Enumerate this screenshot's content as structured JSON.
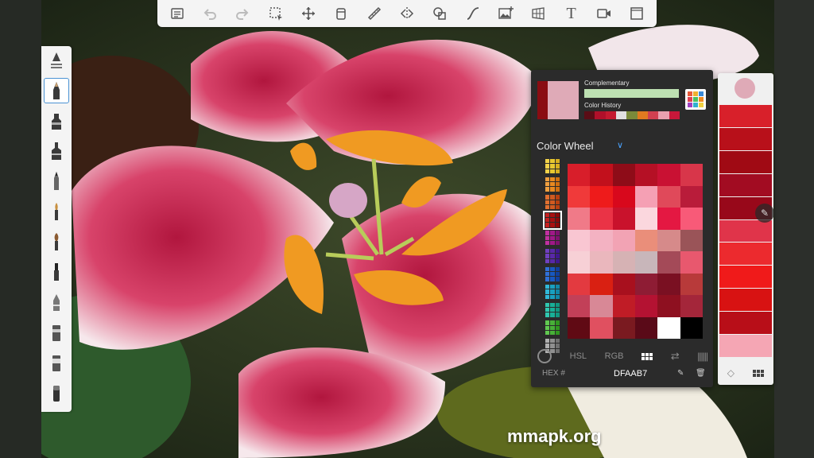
{
  "toolbar": {
    "icons": [
      "list-icon",
      "undo-icon",
      "redo-icon",
      "selection-icon",
      "move-icon",
      "fill-icon",
      "ruler-icon",
      "symmetry-icon",
      "shapes-icon",
      "curve-icon",
      "import-image-icon",
      "perspective-icon",
      "text-icon",
      "video-icon",
      "fullscreen-icon"
    ],
    "text_label": "T"
  },
  "brushes": [
    "brush-settings-icon",
    "pencil-icon",
    "marker-icon",
    "airbrush-icon",
    "ink-pen-icon",
    "paint-brush-icon",
    "round-brush-icon",
    "flat-brush-icon",
    "blender-icon",
    "smudge-icon",
    "solid-fill-icon",
    "eraser-icon"
  ],
  "color_panel": {
    "current_color": "#DFAAB7",
    "previous_color": "#8A0C12",
    "complementary_label": "Complementary",
    "complementary_color": "#BDE0B2",
    "history_label": "Color History",
    "history": [
      "#5a0d16",
      "#b0102a",
      "#c41a30",
      "#e0e0e0",
      "#7a8a3a",
      "#e07a20",
      "#d04050",
      "#e8a0b0",
      "#c8183a"
    ],
    "mode_title": "Color Wheel",
    "modes": {
      "hsl": "HSL",
      "rgb": "RGB"
    },
    "hex_label": "HEX #",
    "hex_value": "DFAAB7",
    "grid_colors": [
      [
        "#d81e2a",
        "#c2101c",
        "#8e0c18",
        "#b51025",
        "#c91133",
        "#d8364a"
      ],
      [
        "#f03a3a",
        "#ee1b1b",
        "#d8081c",
        "#f5a0b4",
        "#e0495a",
        "#b91c3a"
      ],
      [
        "#f07a88",
        "#ea3346",
        "#c9122c",
        "#fbd7de",
        "#e41842",
        "#f85a78"
      ],
      [
        "#f9c6d2",
        "#f3b2c2",
        "#f2a3b4",
        "#ea8e7a",
        "#d68a8a",
        "#9a5458"
      ],
      [
        "#f7d0d6",
        "#eab7bd",
        "#d6b2b4",
        "#c8b6ba",
        "#a44a58",
        "#e8586e"
      ],
      [
        "#e33a40",
        "#d92012",
        "#a8101e",
        "#8e1c34",
        "#7a1022",
        "#b83a3a"
      ],
      [
        "#c24058",
        "#d88896",
        "#c01c26",
        "#b41232",
        "#8e1020",
        "#a4263a"
      ],
      [
        "#600a14",
        "#e05060",
        "#7a1a20",
        "#5a0a18",
        "#ffffff",
        "#000000"
      ]
    ],
    "families": [
      [
        "#f2d24a",
        "#e8c830",
        "#d8b020"
      ],
      [
        "#f0a040",
        "#e88a20",
        "#d07010"
      ],
      [
        "#e07030",
        "#d05a20",
        "#b84010"
      ],
      [
        "#c42020",
        "#a81010",
        "#8c0808"
      ],
      [
        "#c030a0",
        "#a01888",
        "#801070"
      ],
      [
        "#7040c0",
        "#5828a8",
        "#401890"
      ],
      [
        "#3070d8",
        "#1858c0",
        "#1040a0"
      ],
      [
        "#30b8d8",
        "#18a0c0",
        "#1088a8"
      ],
      [
        "#30c8b0",
        "#18b098",
        "#109880"
      ],
      [
        "#60c850",
        "#48b038",
        "#309820"
      ],
      [
        "#b0b0b0",
        "#909090",
        "#707070"
      ]
    ]
  },
  "swatch_strip": {
    "current": "#DFAAB7",
    "swatches": [
      "#d8202a",
      "#b8101a",
      "#a00a14",
      "#a20c22",
      "#98081a",
      "#e0344a",
      "#ec2a2e",
      "#f01a1a",
      "#d81212",
      "#b80e18",
      "#f5a6b4"
    ]
  },
  "watermark": "mmapk.org"
}
